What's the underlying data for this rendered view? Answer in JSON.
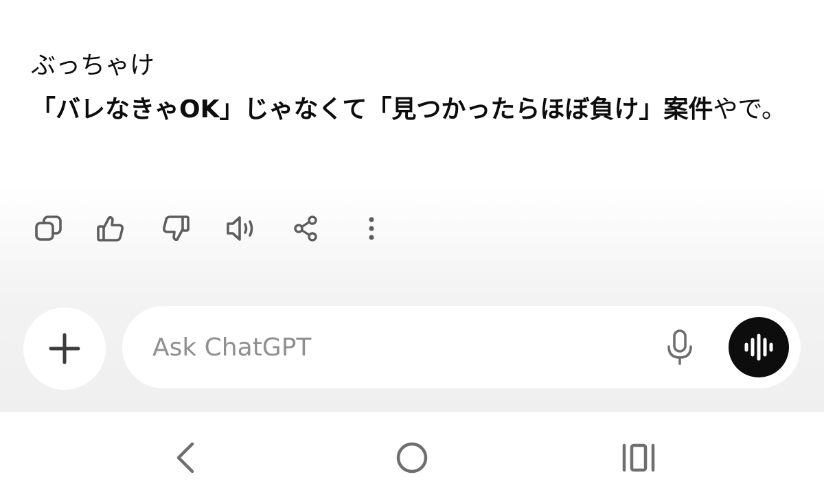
{
  "message": {
    "line1": "ぶっちゃけ",
    "bold_text": "「バレなきゃOK」じゃなくて「見つかったらほぼ負け」案件",
    "normal_tail": "やで。"
  },
  "actions": [
    {
      "name": "copy",
      "icon": "copy-icon"
    },
    {
      "name": "good-response",
      "icon": "thumbs-up-icon"
    },
    {
      "name": "bad-response",
      "icon": "thumbs-down-icon"
    },
    {
      "name": "read-aloud",
      "icon": "speaker-icon"
    },
    {
      "name": "share",
      "icon": "share-icon"
    },
    {
      "name": "more",
      "icon": "more-vertical-icon"
    }
  ],
  "composer": {
    "placeholder": "Ask ChatGPT",
    "value": ""
  },
  "icons": {
    "plus": "plus-icon",
    "mic": "microphone-icon",
    "voice": "voice-mode-icon",
    "nav_back": "chevron-left-icon",
    "nav_home": "circle-home-icon",
    "nav_recents": "recent-apps-icon"
  },
  "colors": {
    "text": "#0d0d0d",
    "icon": "#5d5d5d",
    "placeholder": "#8f8f8f",
    "voice_button": "#0d0d0d",
    "background_gradient_end": "#efefef"
  }
}
